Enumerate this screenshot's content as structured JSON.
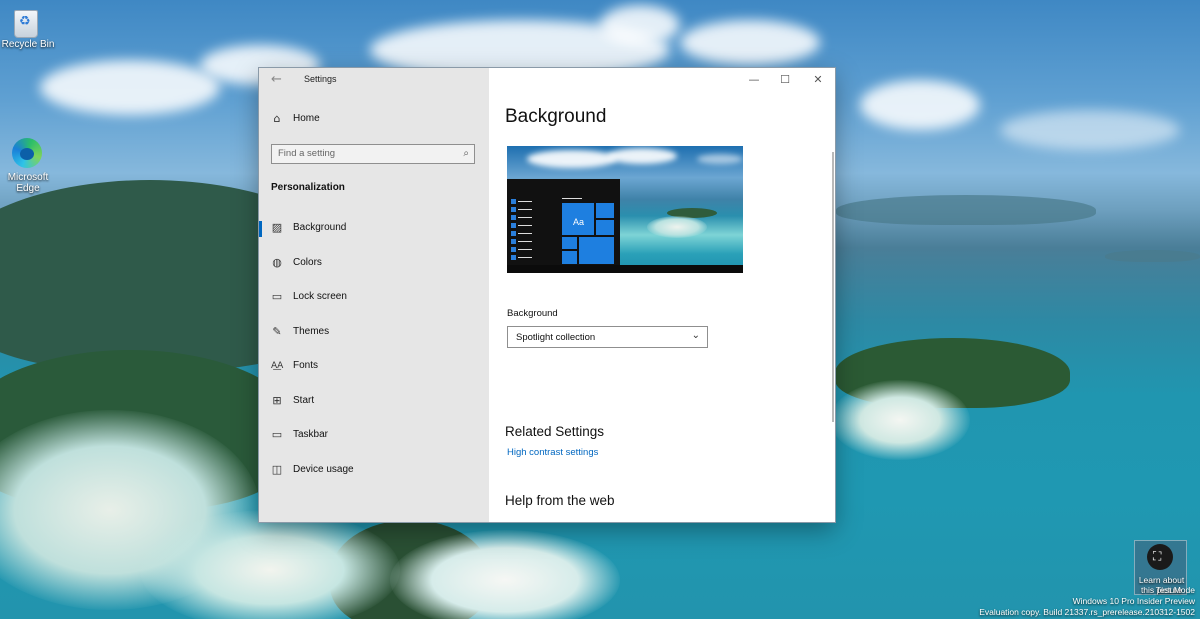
{
  "desktop": {
    "icons": [
      {
        "label": "Recycle Bin"
      },
      {
        "label": "Microsoft Edge"
      }
    ],
    "learn_label": "Learn about this picture",
    "watermark": {
      "mode": "Test Mode",
      "edition": "Windows 10 Pro Insider Preview",
      "build": "Evaluation copy. Build 21337.rs_prerelease.210312-1502"
    }
  },
  "window": {
    "title": "Settings",
    "controls": {
      "minimize": "—",
      "maximize": "☐",
      "close": "✕"
    }
  },
  "sidebar": {
    "home": {
      "label": "Home",
      "icon": "home-icon"
    },
    "search": {
      "placeholder": "Find a setting",
      "icon": "search-icon"
    },
    "section": "Personalization",
    "items": [
      {
        "label": "Background",
        "icon": "picture-icon",
        "active": true
      },
      {
        "label": "Colors",
        "icon": "palette-icon"
      },
      {
        "label": "Lock screen",
        "icon": "lock-screen-icon"
      },
      {
        "label": "Themes",
        "icon": "brush-icon"
      },
      {
        "label": "Fonts",
        "icon": "font-icon"
      },
      {
        "label": "Start",
        "icon": "start-icon"
      },
      {
        "label": "Taskbar",
        "icon": "taskbar-icon"
      },
      {
        "label": "Device usage",
        "icon": "device-usage-icon"
      }
    ]
  },
  "main": {
    "title": "Background",
    "preview": {
      "sample_text": "Aa"
    },
    "background_label": "Background",
    "background_value": "Spotlight collection",
    "related_title": "Related Settings",
    "related_link": "High contrast settings",
    "help_title": "Help from the web"
  },
  "colors": {
    "accent": "#0067c0",
    "sidebar_bg": "#e6e6e6",
    "content_bg": "#ffffff"
  }
}
